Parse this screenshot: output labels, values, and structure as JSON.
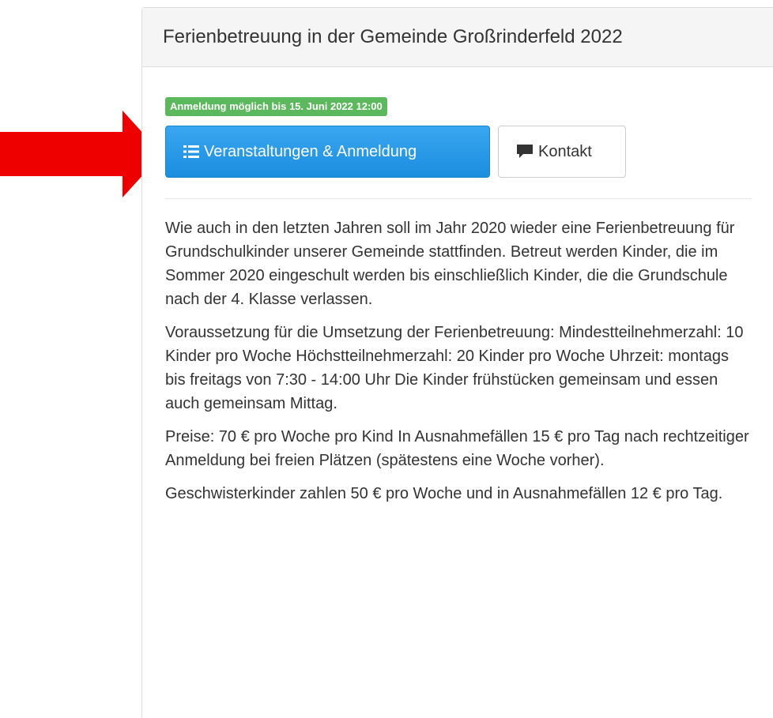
{
  "panel": {
    "title": "Ferienbetreuung in der Gemeinde Großrinderfeld 2022"
  },
  "registration_badge": {
    "text": "Anmeldung möglich bis 15. Juni 2022 12:00",
    "color": "#5cb85c"
  },
  "buttons": {
    "events": {
      "label": "Veranstaltungen & Anmeldung",
      "icon": "list-icon",
      "color": "#2196e8"
    },
    "contact": {
      "label": "Kontakt",
      "icon": "speech-bubble-icon"
    }
  },
  "annotation": {
    "arrow_color": "#ee0000"
  },
  "paragraphs": [
    "Wie auch in den letzten Jahren soll im Jahr 2020 wieder eine Ferienbetreuung für Grundschulkinder unserer Gemeinde stattfinden. Betreut werden Kinder, die im Sommer 2020 eingeschult werden bis einschließlich Kinder, die die Grundschule nach der 4. Klasse verlassen.",
    "Voraussetzung für die Umsetzung der Ferienbetreuung: Mindestteilnehmerzahl: 10 Kinder pro Woche Höchstteilnehmerzahl: 20 Kinder pro Woche Uhrzeit: montags bis freitags von 7:30 - 14:00 Uhr Die Kinder frühstücken gemeinsam und essen auch gemeinsam Mittag.",
    "Preise: 70 € pro Woche pro Kind In Ausnahmefällen 15 € pro Tag nach rechtzeitiger Anmeldung bei freien Plätzen (spätestens eine Woche vorher).",
    "Geschwisterkinder zahlen 50 € pro Woche und in Ausnahmefällen 12 € pro Tag."
  ]
}
